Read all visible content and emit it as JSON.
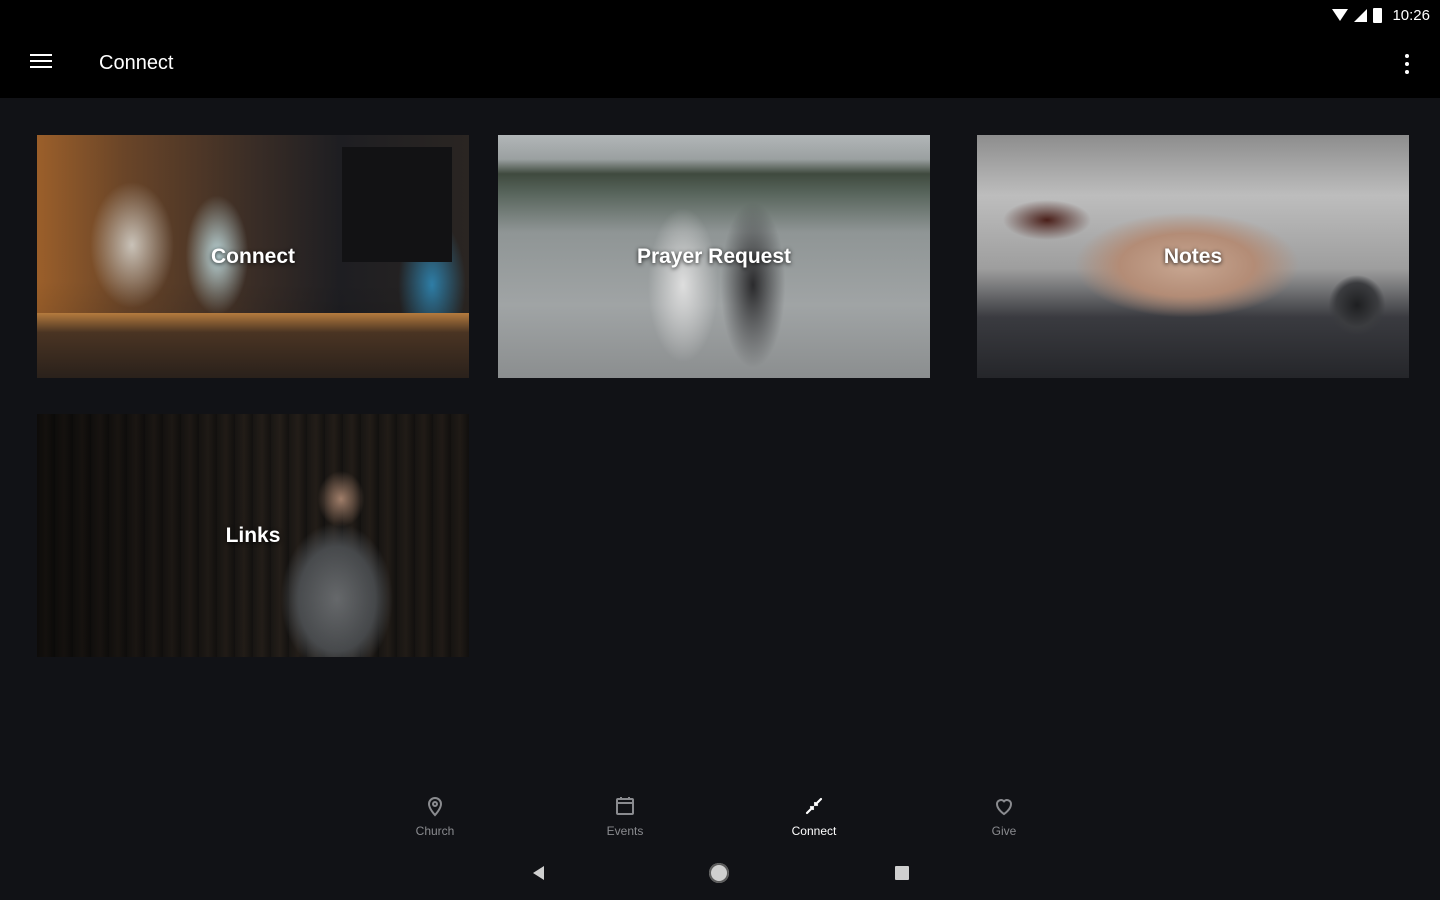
{
  "status_bar": {
    "time": "10:26",
    "icons": [
      "wifi-icon",
      "cell-signal-icon",
      "battery-icon"
    ]
  },
  "app_bar": {
    "title": "Connect",
    "icons": [
      "menu-icon",
      "overflow-menu-icon"
    ]
  },
  "tiles": [
    {
      "label": "Connect"
    },
    {
      "label": "Prayer Request"
    },
    {
      "label": "Notes"
    },
    {
      "label": "Links"
    }
  ],
  "bottom_nav": {
    "items": [
      {
        "label": "Church",
        "icon": "location-pin-icon"
      },
      {
        "label": "Events",
        "icon": "calendar-icon"
      },
      {
        "label": "Connect",
        "icon": "connect-icon"
      },
      {
        "label": "Give",
        "icon": "heart-icon"
      }
    ],
    "active": "Connect"
  },
  "system_nav": {
    "icons": [
      "back-icon",
      "home-icon",
      "recents-icon"
    ]
  },
  "colors": {
    "background": "#111216",
    "app_bar": "#000000",
    "nav_inactive": "#8a8b8f",
    "nav_active": "#ffffff"
  }
}
